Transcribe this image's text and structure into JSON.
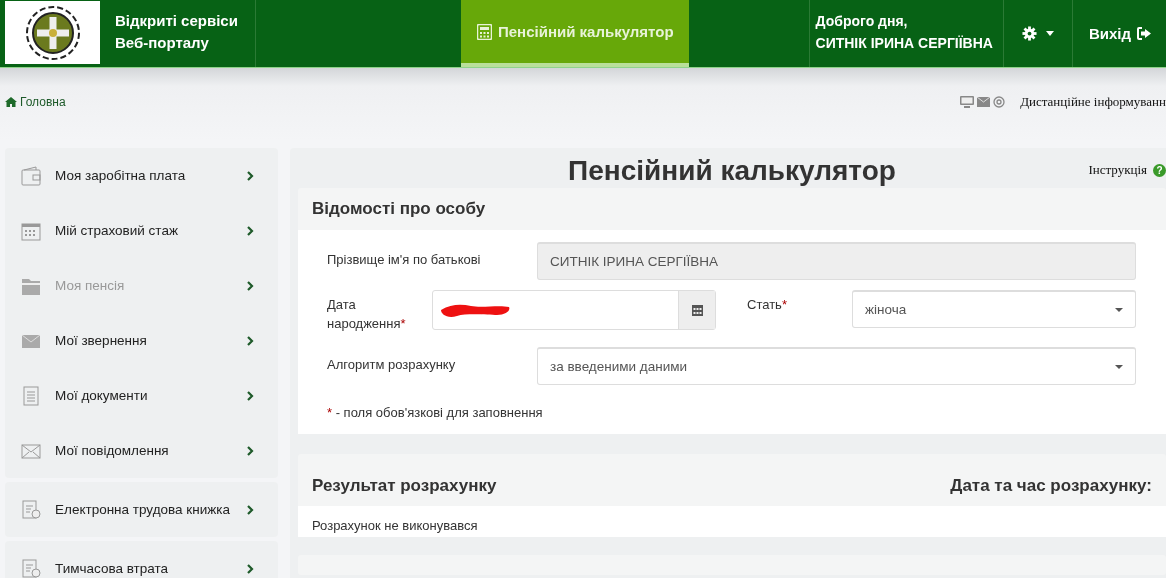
{
  "header": {
    "portal_title": [
      "Відкриті сервіси",
      "Веб-порталу"
    ],
    "nav": [
      {
        "label": "Пенсійний калькулятор",
        "selected": true
      }
    ],
    "greeting": "Доброго дня,",
    "user_name": "СИТНІК ІРИНА СЕРГІЇВНА",
    "logout": "Вихід"
  },
  "breadcrumb": "Головна",
  "notify_label": "Дистанційне інформуванн",
  "sidebar": {
    "groups": [
      {
        "items": [
          {
            "kind": "wallet",
            "label": "Моя заробітна плата",
            "disabled": false
          },
          {
            "kind": "calendar",
            "label": "Мій страховий стаж",
            "disabled": false
          },
          {
            "kind": "folder",
            "label": "Моя пенсія",
            "disabled": true
          },
          {
            "kind": "envelope",
            "label": "Мої звернення",
            "disabled": false
          },
          {
            "kind": "document",
            "label": "Мої документи",
            "disabled": false
          },
          {
            "kind": "envelope-outline",
            "label": "Мої повідомлення",
            "disabled": false
          }
        ]
      },
      {
        "items": [
          {
            "kind": "workbook",
            "label": "Електронна трудова книжка",
            "disabled": false
          }
        ]
      },
      {
        "items": [
          {
            "kind": "workbook",
            "label": "Тимчасова втрата",
            "disabled": false
          }
        ]
      }
    ]
  },
  "page_title": "Пенсійний калькулятор",
  "instruction_link": "Інструкція",
  "instruction_icon": "?",
  "required_mark": "*",
  "person_section": {
    "title": "Відомості про особу",
    "full_name": {
      "label": "Прізвище ім'я по батькові",
      "value": "СИТНІК ІРИНА СЕРГІЇВНА",
      "disabled": true
    },
    "birth_date": {
      "label": "Дата народження",
      "required": true,
      "value_redacted": true
    },
    "sex": {
      "label": "Стать",
      "required": true,
      "value": "жіноча"
    },
    "algorithm": {
      "label": "Алгоритм розрахунку",
      "value": "за введеними даними"
    },
    "required_note": "- поля обов'язкові для заповнення"
  },
  "result_section": {
    "title": "Результат розрахунку",
    "date_label": "Дата та час розрахунку:",
    "message": "Розрахунок не виконувався"
  }
}
